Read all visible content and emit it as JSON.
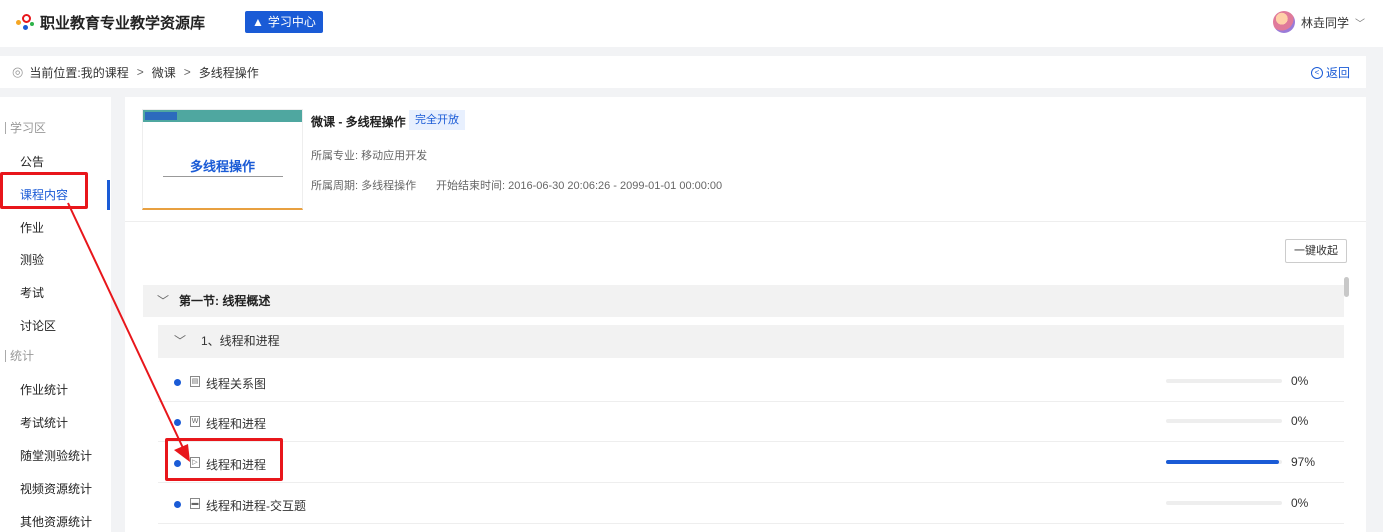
{
  "header": {
    "logo_text": "职业教育专业教学资源库",
    "study_center": "学习中心",
    "user_name": "林垚同学",
    "user_chevron_icon": "chevron-down-icon"
  },
  "breadcrumb": {
    "prefix": "当前位置:",
    "items": [
      "我的课程",
      "微课",
      "多线程操作"
    ],
    "back": "返回"
  },
  "sidebar": {
    "groups": [
      {
        "label": "学习区",
        "items": [
          "公告",
          "课程内容",
          "作业",
          "测验",
          "考试",
          "讨论区"
        ]
      },
      {
        "label": "统计",
        "items": [
          "作业统计",
          "考试统计",
          "随堂测验统计",
          "视频资源统计",
          "其他资源统计"
        ]
      }
    ],
    "active": "课程内容"
  },
  "course": {
    "thumb_title": "多线程操作",
    "title": "微课 - 多线程操作",
    "badge": "完全开放",
    "major": "所属专业: 移动应用开发",
    "cycle": "所属周期: 多线程操作",
    "time": "开始结束时间: 2016-06-30 20:06:26 - 2099-01-01 00:00:00"
  },
  "toolbar": {
    "collapse_all": "一键收起"
  },
  "outline": {
    "section_title": "第一节: 线程概述",
    "subsection_title": "1、线程和进程",
    "resources": [
      {
        "icon": "image-doc-icon",
        "label": "线程关系图",
        "progress": 0,
        "progress_text": "0%"
      },
      {
        "icon": "word-doc-icon",
        "label": "线程和进程",
        "progress": 0,
        "progress_text": "0%"
      },
      {
        "icon": "video-icon",
        "label": "线程和进程",
        "progress": 0.97,
        "progress_text": "97%"
      },
      {
        "icon": "interactive-icon",
        "label": "线程和进程-交互题",
        "progress": 0,
        "progress_text": "0%"
      }
    ]
  },
  "annotations": {
    "color": "#e8161b"
  },
  "colors": {
    "accent": "#1a5bd6"
  }
}
